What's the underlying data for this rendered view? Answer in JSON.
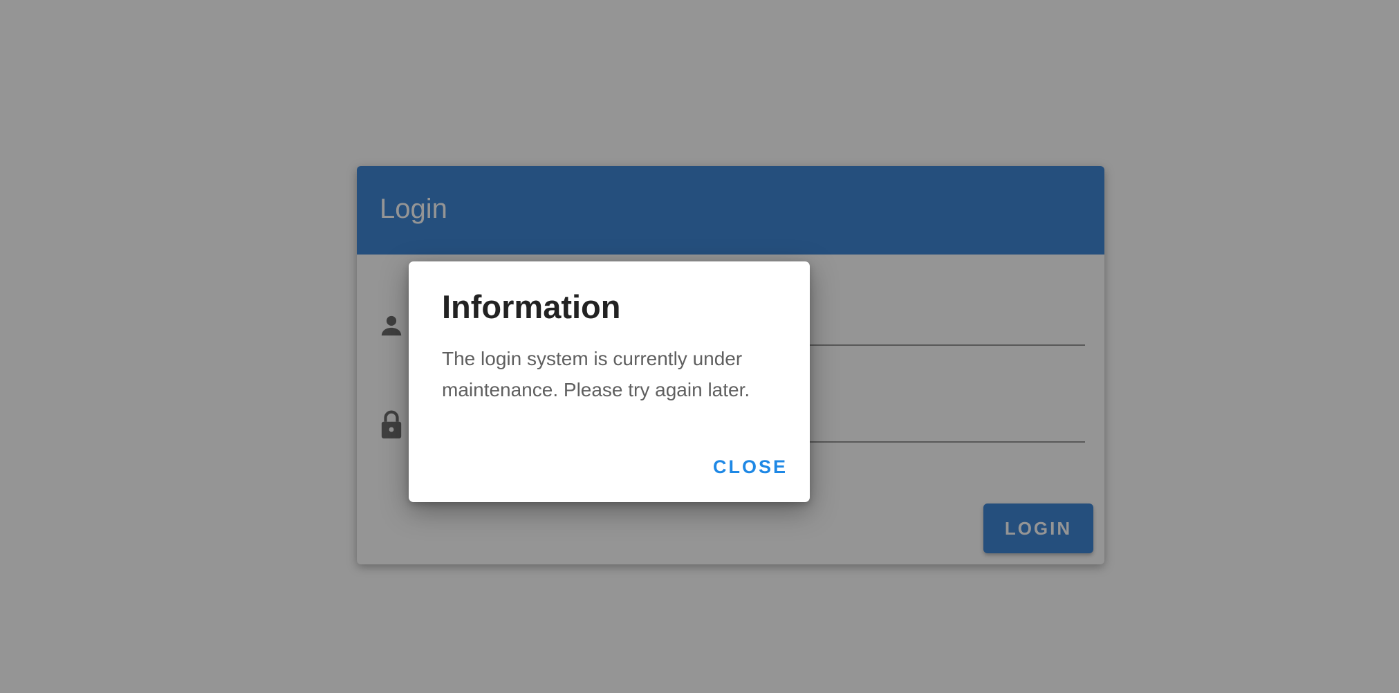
{
  "login": {
    "title": "Login",
    "username_icon": "person-icon",
    "password_icon": "lock-icon",
    "username_value": "",
    "password_value": "",
    "button_label": "LOGIN",
    "accent_color": "#2979d2"
  },
  "dialog": {
    "title": "Information",
    "message": "The login system is currently under maintenance. Please try again later.",
    "close_label": "CLOSE",
    "close_color": "#1e88e5"
  }
}
